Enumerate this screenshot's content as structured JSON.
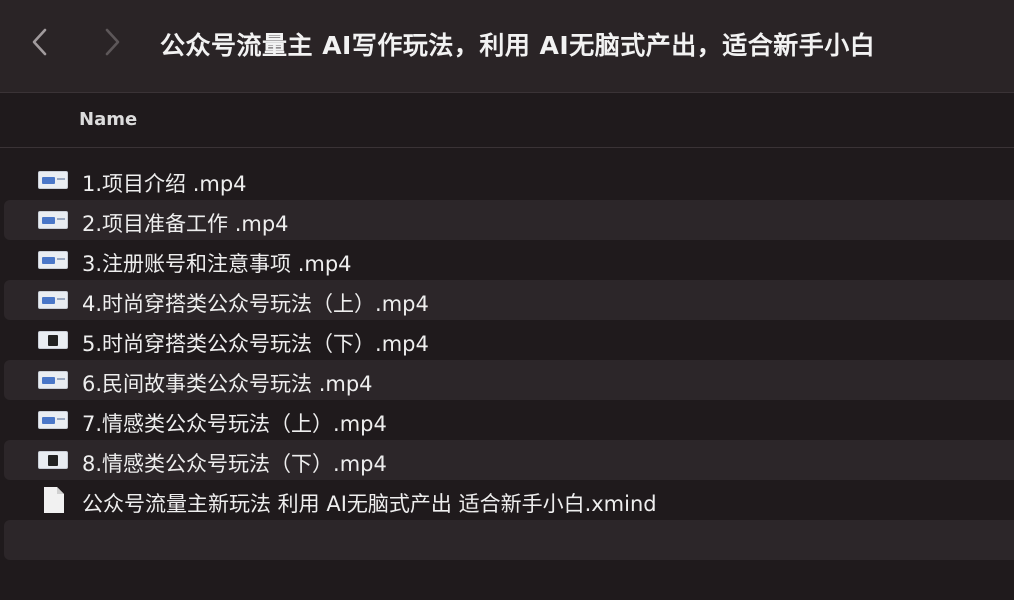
{
  "window": {
    "title": "公众号流量主 AI写作玩法，利用 AI无脑式产出，适合新手小白"
  },
  "header": {
    "name_column": "Name"
  },
  "files": [
    {
      "name": "1.项目介绍 .mp4",
      "icon": "video-file-icon"
    },
    {
      "name": "2.项目准备工作 .mp4",
      "icon": "video-file-icon"
    },
    {
      "name": "3.注册账号和注意事项 .mp4",
      "icon": "video-file-icon"
    },
    {
      "name": "4.时尚穿搭类公众号玩法（上）.mp4",
      "icon": "video-file-icon"
    },
    {
      "name": "5.时尚穿搭类公众号玩法（下）.mp4",
      "icon": "video-file-icon"
    },
    {
      "name": "6.民间故事类公众号玩法 .mp4",
      "icon": "video-file-icon"
    },
    {
      "name": "7.情感类公众号玩法（上）.mp4",
      "icon": "video-file-icon"
    },
    {
      "name": "8.情感类公众号玩法（下）.mp4",
      "icon": "video-file-icon"
    },
    {
      "name": "公众号流量主新玩法 利用 AI无脑式产出 适合新手小白.xmind",
      "icon": "document-file-icon"
    }
  ],
  "colors": {
    "background": "#1f1a1c",
    "alt_row": "#2c2629",
    "toolbar": "#2a2426"
  }
}
